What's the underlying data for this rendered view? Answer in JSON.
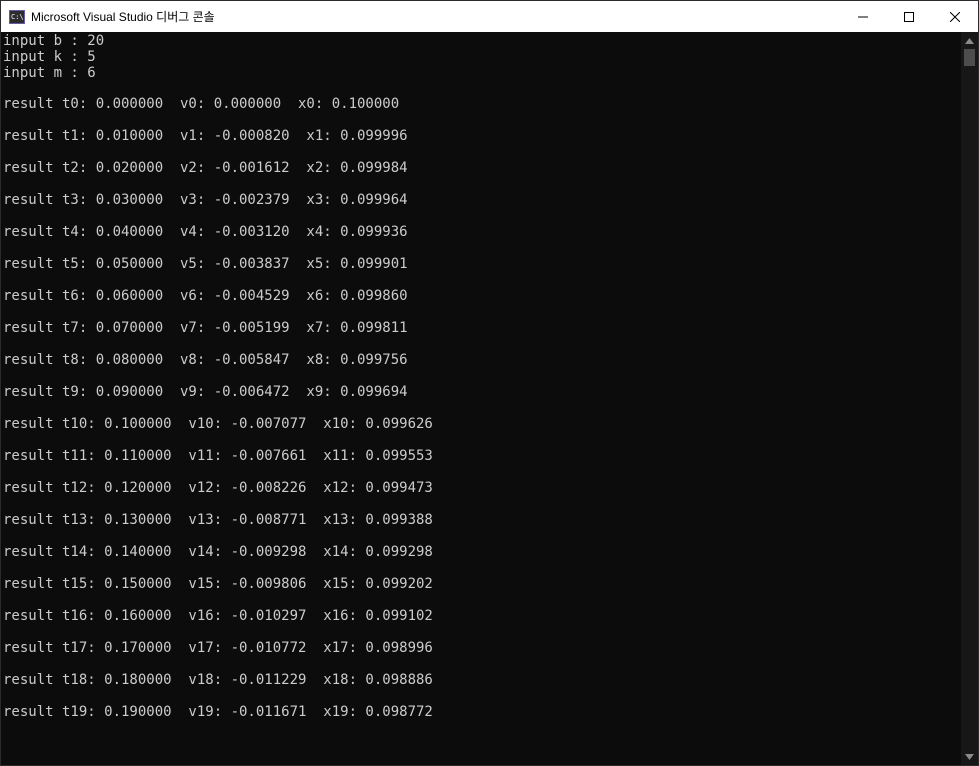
{
  "window": {
    "title": "Microsoft Visual Studio 디버그 콘솔"
  },
  "console": {
    "inputs": [
      "input b : 20",
      "input k : 5",
      "input m : 6"
    ],
    "results": [
      "result t0: 0.000000  v0: 0.000000  x0: 0.100000",
      "result t1: 0.010000  v1: -0.000820  x1: 0.099996",
      "result t2: 0.020000  v2: -0.001612  x2: 0.099984",
      "result t3: 0.030000  v3: -0.002379  x3: 0.099964",
      "result t4: 0.040000  v4: -0.003120  x4: 0.099936",
      "result t5: 0.050000  v5: -0.003837  x5: 0.099901",
      "result t6: 0.060000  v6: -0.004529  x6: 0.099860",
      "result t7: 0.070000  v7: -0.005199  x7: 0.099811",
      "result t8: 0.080000  v8: -0.005847  x8: 0.099756",
      "result t9: 0.090000  v9: -0.006472  x9: 0.099694",
      "result t10: 0.100000  v10: -0.007077  x10: 0.099626",
      "result t11: 0.110000  v11: -0.007661  x11: 0.099553",
      "result t12: 0.120000  v12: -0.008226  x12: 0.099473",
      "result t13: 0.130000  v13: -0.008771  x13: 0.099388",
      "result t14: 0.140000  v14: -0.009298  x14: 0.099298",
      "result t15: 0.150000  v15: -0.009806  x15: 0.099202",
      "result t16: 0.160000  v16: -0.010297  x16: 0.099102",
      "result t17: 0.170000  v17: -0.010772  x17: 0.098996",
      "result t18: 0.180000  v18: -0.011229  x18: 0.098886",
      "result t19: 0.190000  v19: -0.011671  x19: 0.098772"
    ]
  },
  "colors": {
    "console_background": "#0c0c0c",
    "console_text": "#cccccc",
    "titlebar_background": "#ffffff"
  },
  "icons": {
    "app": "console-app-icon",
    "minimize": "minimize-icon",
    "maximize": "maximize-icon",
    "close": "close-icon",
    "scroll_up": "scroll-up-icon",
    "scroll_down": "scroll-down-icon"
  }
}
